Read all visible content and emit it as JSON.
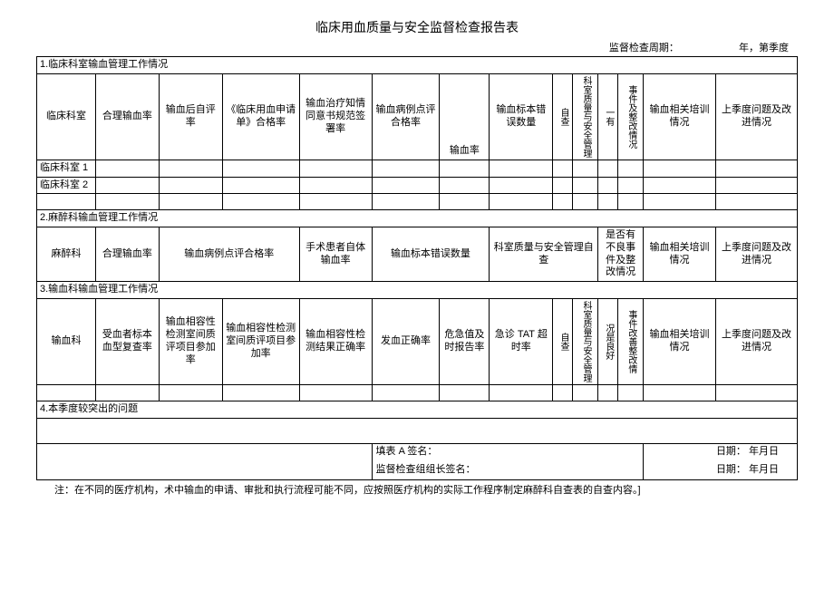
{
  "title": "临床用血质量与安全监督检查报告表",
  "period": {
    "label": "监督检查周期：",
    "suffix": "年，第季度"
  },
  "sec1": {
    "heading": "1.临床科室输血管理工作情况",
    "cols": {
      "c1": "临床科室",
      "c2": "合理输血率",
      "c3": "输血后自评率",
      "c4": "《临床用血申请单》合格率",
      "c5": "输血治疗知情同意书规范签署率",
      "c6": "输血病例点评合格率",
      "c7": "输血率",
      "c8": "输血标本错误数量",
      "c9a": "自查",
      "c9b": "科室质量与安全管理",
      "c10a": "事件及整改情况",
      "c10b": "一有",
      "c11": "输血相关培训情况",
      "c12": "上季度问题及改进情况"
    },
    "rows": {
      "r1": "临床科室 1",
      "r2": "临床科室 2"
    }
  },
  "sec2": {
    "heading": "2.麻醉科输血管理工作情况",
    "cols": {
      "c1": "麻醉科",
      "c2": "合理输血率",
      "c3": "输血病例点评合格率",
      "c4": "手术患者自体输血率",
      "c5": "输血标本错误数量",
      "c6": "科室质量与安全管理自查",
      "c7": "是否有不良事件及整改情况",
      "c8": "输血相关培训情况",
      "c9": "上季度问题及改进情况"
    }
  },
  "sec3": {
    "heading": "3.输血科输血管理工作情况",
    "cols": {
      "c1": "输血科",
      "c2": "受血者标本血型复查率",
      "c3": "输血相容性检测室间质评项目参加率",
      "c4": "输血相容性检测室间质评项目参加率",
      "c5": "输血相容性检测结果正确率",
      "c6": "发血正确率",
      "c7": "危急值及时报告率",
      "c8": "急诊 TAT 超时率",
      "c9a": "自查",
      "c9b": "科室质量与安全管理",
      "c10a": "况是良好",
      "c10b": "事件改善整改情",
      "c11": "输血相关培训情况",
      "c12": "上季度问题及改进情况"
    }
  },
  "sec4": {
    "heading": "4.本季度较突出的问题"
  },
  "sign": {
    "filler": "填表 A 签名：",
    "date1": "日期：      年月日",
    "leader": "监督检查组组长签名：",
    "date2": "日期：      年月日"
  },
  "note": "注：在不同的医疗机构，术中输血的申请、审批和执行流程可能不同，应按照医疗机构的实际工作程序制定麻醉科自查表的自查内容。]"
}
